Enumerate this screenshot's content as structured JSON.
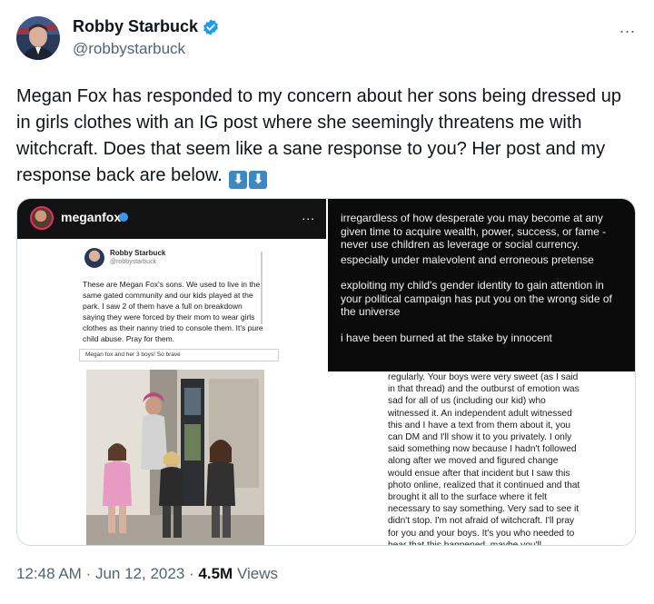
{
  "author": {
    "display_name": "Robby Starbuck",
    "handle": "@robbystarbuck"
  },
  "tweet": {
    "text": "Megan Fox has responded to my concern about her sons being dressed up in girls clothes with an IG post where she seemingly threatens me with witchcraft. Does that seem like a sane response to you? Her post and my response back are below.",
    "emoji_1": "⬇",
    "emoji_2": "⬇"
  },
  "more_icon": "...",
  "media": {
    "left": {
      "ig_username": "meganfox",
      "ig_more": "...",
      "inner_tweet": {
        "display_name": "Robby Starbuck",
        "handle": "@robbystarbuck",
        "text": "These are Megan Fox's sons. We used to live in the same gated community and our kids played at the park. I saw 2 of them have a full on breakdown saying they were forced by their mom to wear girls clothes as their nanny tried to console them. It's pure child abuse. Pray for them.",
        "caption": "Megan fox and her 3 boys! So brave"
      }
    },
    "right": {
      "dark_paragraphs": [
        "irregardless of how desperate you may become at any given time to acquire wealth, power, success, or fame - never use children as leverage or social currency.",
        "especially under malevolent and erroneous pretense",
        "exploiting my child's gender identity to gain attention in your political campaign has put you on the wrong side of the universe",
        "i have been burned at the stake by innocent"
      ],
      "reply_text": "regularly. Your boys were very sweet (as I said in that thread) and the outburst of emotion was sad for all of us (including our kid) who witnessed it. An independent adult witnessed this and I have a text from them about it, you can DM and I'll show it to you privately. I only said something now because I hadn't followed along after we moved and figured change would ensue after that incident but I saw this photo online, realized that it continued and that brought it all to the surface where it felt necessary to say something. Very sad to see it didn't stop. I'm not afraid of witchcraft. I'll pray for you and your boys. It's you who needed to hear that this happened, maybe you'll investigate those feelings that burst out"
    }
  },
  "meta": {
    "time": "12:48 AM",
    "separator": "·",
    "date": "Jun 12, 2023",
    "views_count": "4.5M",
    "views_label": "Views"
  },
  "colors": {
    "verified_blue": "#1d9bf0",
    "secondary_text": "#536471",
    "emoji_blue": "#3b88c3"
  }
}
